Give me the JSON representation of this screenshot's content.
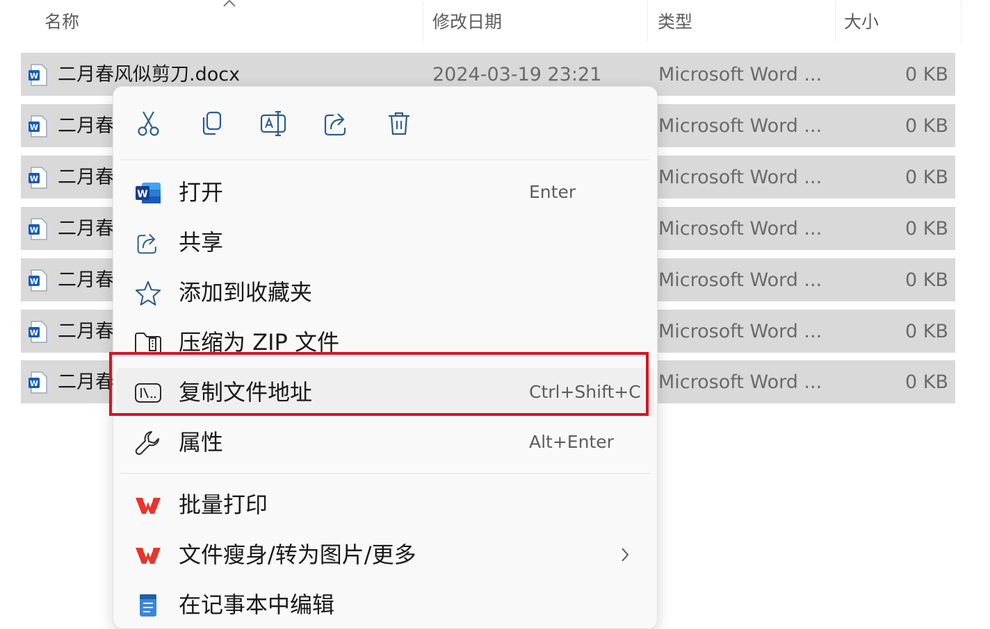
{
  "columns": {
    "name": "名称",
    "modified": "修改日期",
    "type": "类型",
    "size": "大小"
  },
  "files": [
    {
      "name": "二月春风似剪刀.docx",
      "date": "2024-03-19 23:21",
      "type": "Microsoft Word ...",
      "size": "0 KB"
    },
    {
      "name": "二月春",
      "date": "",
      "type": "Microsoft Word ...",
      "size": "0 KB"
    },
    {
      "name": "二月春",
      "date": "",
      "type": "Microsoft Word ...",
      "size": "0 KB"
    },
    {
      "name": "二月春",
      "date": "",
      "type": "Microsoft Word ...",
      "size": "0 KB"
    },
    {
      "name": "二月春",
      "date": "",
      "type": "Microsoft Word ...",
      "size": "0 KB"
    },
    {
      "name": "二月春",
      "date": "",
      "type": "Microsoft Word ...",
      "size": "0 KB"
    },
    {
      "name": "二月春",
      "date": "",
      "type": "Microsoft Word ...",
      "size": "0 KB"
    }
  ],
  "quick_actions": [
    {
      "icon": "scissors-icon",
      "action": "cut"
    },
    {
      "icon": "copy-icon",
      "action": "copy"
    },
    {
      "icon": "rename-icon",
      "action": "rename"
    },
    {
      "icon": "share-icon",
      "action": "share"
    },
    {
      "icon": "trash-icon",
      "action": "delete"
    }
  ],
  "menu": {
    "open": {
      "label": "打开",
      "shortcut": "Enter",
      "icon": "word-icon"
    },
    "share": {
      "label": "共享",
      "icon": "share-icon"
    },
    "favorites": {
      "label": "添加到收藏夹",
      "icon": "star-icon"
    },
    "zip": {
      "label": "压缩为 ZIP 文件",
      "icon": "zip-folder-icon"
    },
    "copy_path": {
      "label": "复制文件地址",
      "shortcut": "Ctrl+Shift+C",
      "icon": "path-icon"
    },
    "properties": {
      "label": "属性",
      "shortcut": "Alt+Enter",
      "icon": "wrench-icon"
    },
    "batch_print": {
      "label": "批量打印",
      "icon": "wps-icon"
    },
    "more": {
      "label": "文件瘦身/转为图片/更多",
      "icon": "wps-icon"
    },
    "notepad": {
      "label": "在记事本中编辑",
      "icon": "notepad-icon"
    }
  },
  "colors": {
    "row_bg": "#d9d9d9",
    "menu_bg": "#f9f9f9",
    "highlight_border": "#d9131f",
    "word_blue": "#185abd",
    "wps_red": "#e8352b"
  }
}
